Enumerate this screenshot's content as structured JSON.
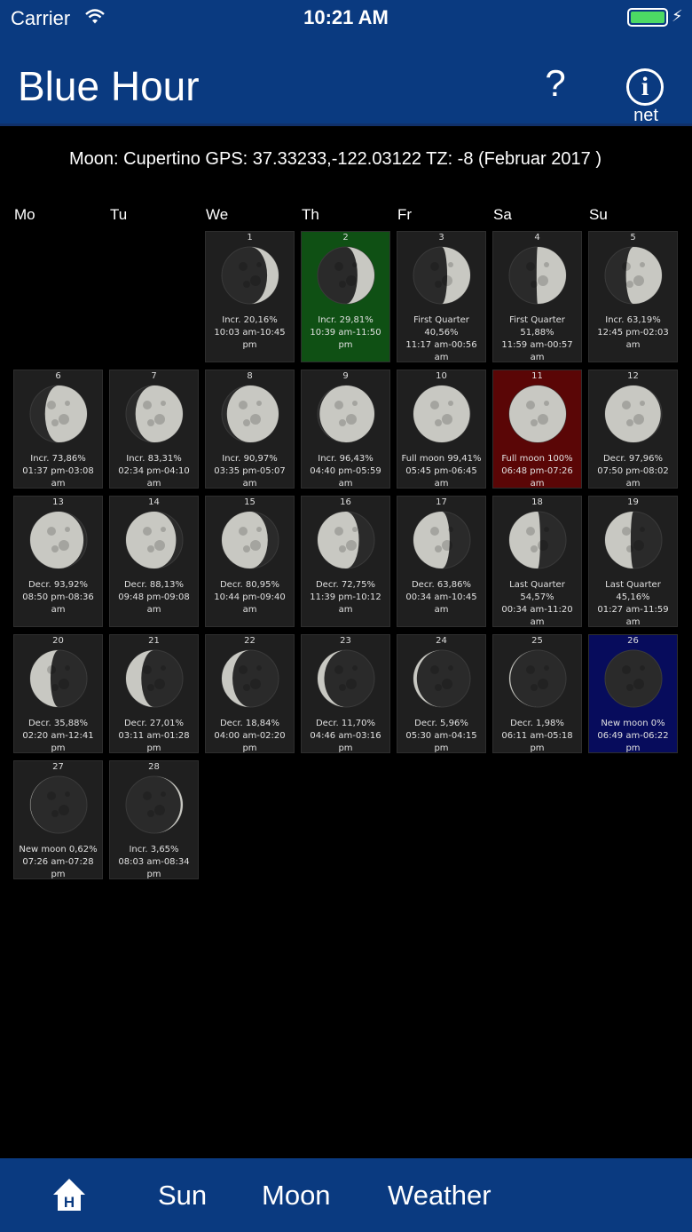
{
  "status_bar": {
    "carrier": "Carrier",
    "time": "10:21 AM"
  },
  "nav": {
    "title": "Blue Hour",
    "help_label": "?",
    "info_label": "i",
    "info_caption": "net"
  },
  "header_text": "Moon: Cupertino GPS: 37.33233,-122.03122 TZ: -8 (Februar 2017 )",
  "weekdays": [
    "Mo",
    "Tu",
    "We",
    "Th",
    "Fr",
    "Sa",
    "Su"
  ],
  "days": [
    {
      "num": "1",
      "text": "Incr. 20,16%\n10:03 am-10:45\npm"
    },
    {
      "num": "2",
      "text": "Incr. 29,81%\n10:39 am-11:50\npm",
      "highlight": "green"
    },
    {
      "num": "3",
      "text": "First Quarter\n40,56%\n11:17 am-00:56\nam"
    },
    {
      "num": "4",
      "text": "First Quarter\n51,88%\n11:59 am-00:57\nam"
    },
    {
      "num": "5",
      "text": "Incr. 63,19%\n12:45 pm-02:03\nam"
    },
    {
      "num": "6",
      "text": "Incr. 73,86%\n01:37 pm-03:08\nam"
    },
    {
      "num": "7",
      "text": "Incr. 83,31%\n02:34 pm-04:10\nam"
    },
    {
      "num": "8",
      "text": "Incr. 90,97%\n03:35 pm-05:07\nam"
    },
    {
      "num": "9",
      "text": "Incr. 96,43%\n04:40 pm-05:59\nam"
    },
    {
      "num": "10",
      "text": "Full moon 99,41%\n05:45 pm-06:45\nam"
    },
    {
      "num": "11",
      "text": "Full moon 100%\n06:48 pm-07:26\nam",
      "highlight": "red"
    },
    {
      "num": "12",
      "text": "Decr. 97,96%\n07:50 pm-08:02\nam"
    },
    {
      "num": "13",
      "text": "Decr. 93,92%\n08:50 pm-08:36\nam"
    },
    {
      "num": "14",
      "text": "Decr. 88,13%\n09:48 pm-09:08\nam"
    },
    {
      "num": "15",
      "text": "Decr. 80,95%\n10:44 pm-09:40\nam"
    },
    {
      "num": "16",
      "text": "Decr. 72,75%\n11:39 pm-10:12\nam"
    },
    {
      "num": "17",
      "text": "Decr. 63,86%\n00:34 am-10:45\nam"
    },
    {
      "num": "18",
      "text": "Last Quarter\n54,57%\n00:34 am-11:20\nam"
    },
    {
      "num": "19",
      "text": "Last Quarter\n45,16%\n01:27 am-11:59\nam"
    },
    {
      "num": "20",
      "text": "Decr. 35,88%\n02:20 am-12:41\npm"
    },
    {
      "num": "21",
      "text": "Decr. 27,01%\n03:11 am-01:28\npm"
    },
    {
      "num": "22",
      "text": "Decr. 18,84%\n04:00 am-02:20\npm"
    },
    {
      "num": "23",
      "text": "Decr. 11,70%\n04:46 am-03:16\npm"
    },
    {
      "num": "24",
      "text": "Decr. 5,96%\n05:30 am-04:15\npm"
    },
    {
      "num": "25",
      "text": "Decr. 1,98%\n06:11 am-05:18\npm"
    },
    {
      "num": "26",
      "text": "New moon 0%\n06:49 am-06:22\npm",
      "highlight": "blue"
    },
    {
      "num": "27",
      "text": "New moon 0,62%\n07:26 am-07:28\npm"
    },
    {
      "num": "28",
      "text": "Incr. 3,65%\n08:03 am-08:34\npm"
    }
  ],
  "tabs": {
    "home_icon": "home-icon",
    "sun": "Sun",
    "moon": "Moon",
    "weather": "Weather"
  },
  "colors": {
    "bar": "#0a3a80",
    "cell": "#1f1f1f",
    "today": "#0f5014",
    "full_moon": "#5a0606",
    "new_moon": "#070c5c"
  }
}
